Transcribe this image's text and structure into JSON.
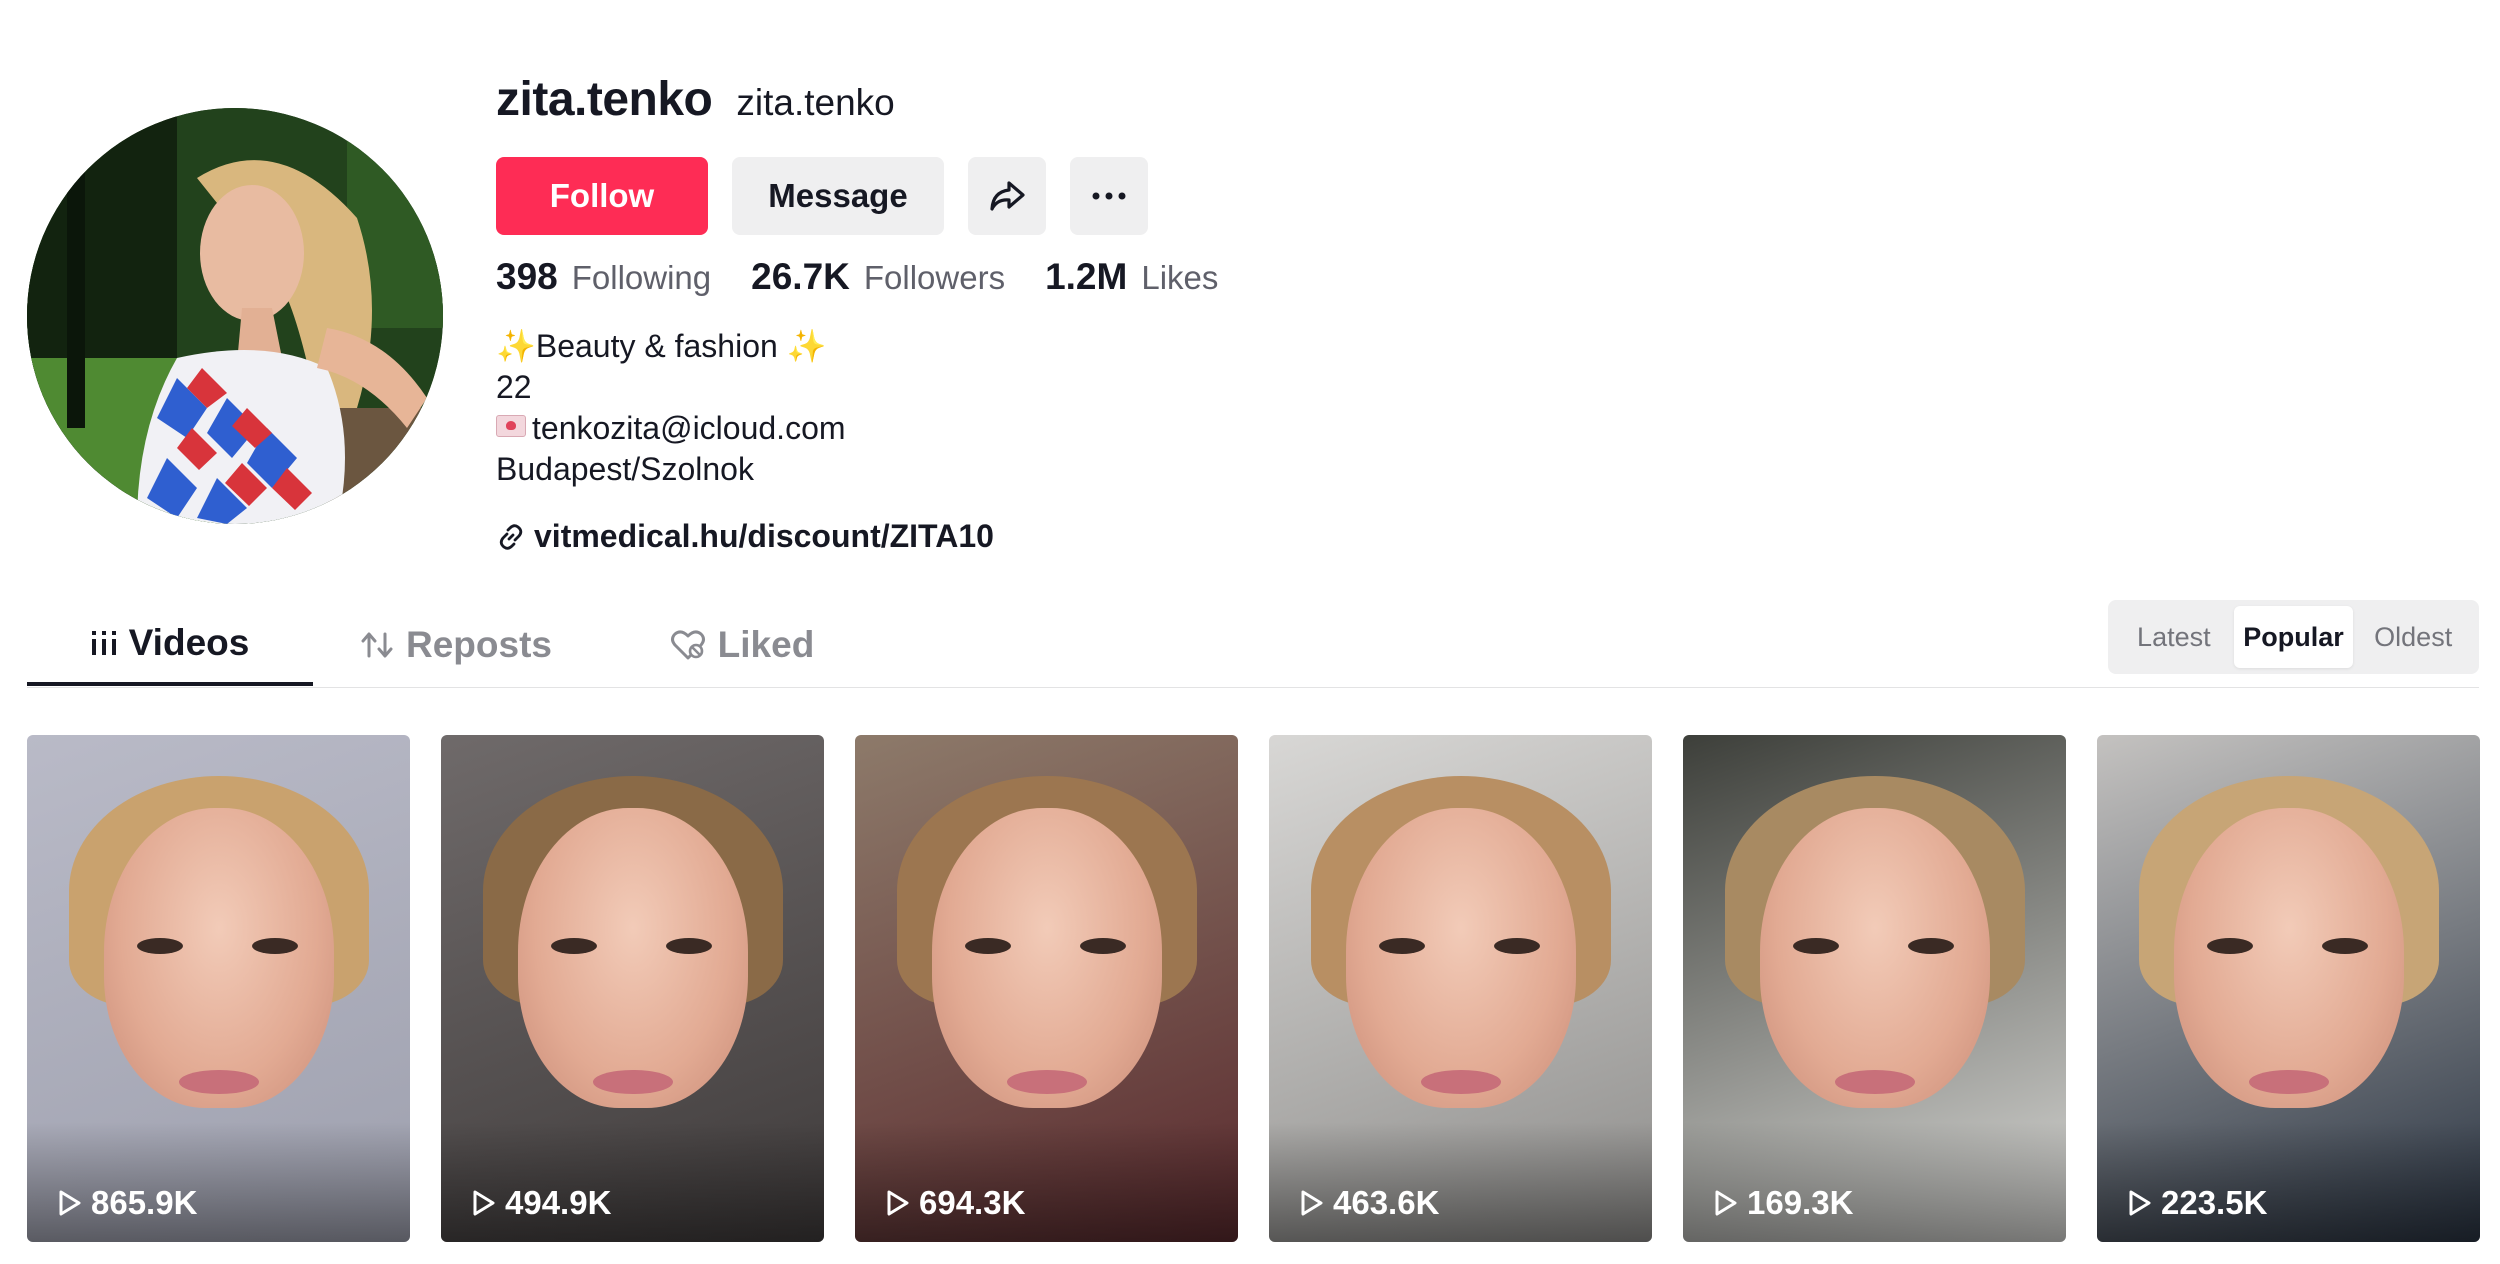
{
  "profile": {
    "title": "zita.tenko",
    "subtitle": "zita.tenko",
    "avatar_alt": "profile-photo"
  },
  "actions": {
    "follow_label": "Follow",
    "message_label": "Message",
    "share_icon": "share-arrow-icon",
    "more_icon": "more-horizontal-icon"
  },
  "stats": [
    {
      "value": "398",
      "label": "Following"
    },
    {
      "value": "26.7K",
      "label": "Followers"
    },
    {
      "value": "1.2M",
      "label": "Likes"
    }
  ],
  "bio": {
    "line1": "✨Beauty & fashion ✨",
    "line2": "22",
    "line3": "tenkozita@icloud.com",
    "line4": "Budapest/Szolnok"
  },
  "link": {
    "text": "vitmedical.hu/discount/ZITA10",
    "icon": "link-icon"
  },
  "tabs": [
    {
      "label": "Videos",
      "icon": "grid-icon"
    },
    {
      "label": "Reposts",
      "icon": "repost-icon"
    },
    {
      "label": "Liked",
      "icon": "liked-icon"
    }
  ],
  "sort": {
    "options": [
      "Latest",
      "Popular",
      "Oldest"
    ],
    "selected": "Popular"
  },
  "videos": [
    {
      "views": "865.9K"
    },
    {
      "views": "494.9K"
    },
    {
      "views": "694.3K"
    },
    {
      "views": "463.6K"
    },
    {
      "views": "169.3K"
    },
    {
      "views": "223.5K"
    }
  ],
  "colors": {
    "accent": "#fe2c55",
    "button_gray": "#efeff0",
    "text": "#161823",
    "muted": "#5f606a"
  }
}
